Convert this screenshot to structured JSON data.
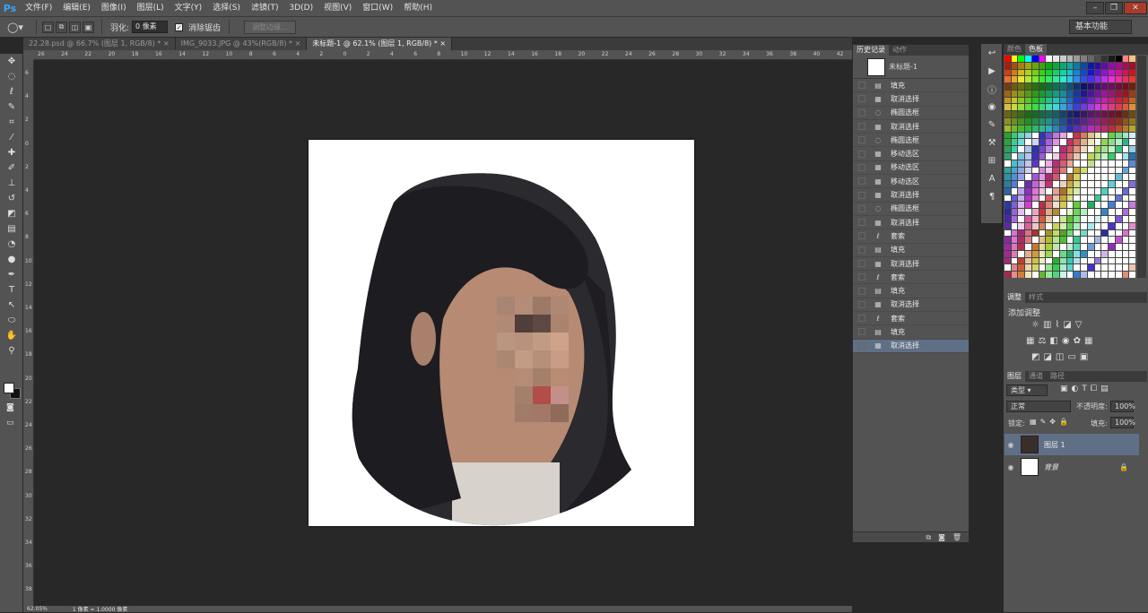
{
  "app": {
    "logo": "Ps"
  },
  "menu": [
    "文件(F)",
    "编辑(E)",
    "图像(I)",
    "图层(L)",
    "文字(Y)",
    "选择(S)",
    "滤镜(T)",
    "3D(D)",
    "视图(V)",
    "窗口(W)",
    "帮助(H)"
  ],
  "options": {
    "feather_label": "羽化:",
    "feather_value": "0 像素",
    "antialias_label": "消除锯齿",
    "refine_label": "调整边缘..."
  },
  "workspace": "基本功能",
  "tabs": [
    {
      "label": "22.28.psd @ 66.7% (图层 1, RGB/8) *"
    },
    {
      "label": "IMG_9033.JPG @ 43%(RGB/8) *"
    },
    {
      "label": "未标题-1 @ 62.1% (图层 1, RGB/8) *"
    }
  ],
  "ruler_top": [
    "26",
    "24",
    "22",
    "20",
    "18",
    "16",
    "14",
    "12",
    "10",
    "8",
    "6",
    "4",
    "2",
    "0",
    "2",
    "4",
    "6",
    "8",
    "10",
    "12",
    "14",
    "16",
    "18",
    "20",
    "22",
    "24",
    "26",
    "28",
    "30",
    "32",
    "34",
    "36",
    "38",
    "40",
    "42"
  ],
  "ruler_left": [
    "6",
    "4",
    "2",
    "0",
    "2",
    "4",
    "6",
    "8",
    "10",
    "12",
    "14",
    "16",
    "18",
    "20",
    "22",
    "24",
    "26",
    "28",
    "30",
    "32",
    "34",
    "36",
    "38"
  ],
  "status": {
    "zoom": "62.05%",
    "info": "1 像素 = 1.0000 像素"
  },
  "history": {
    "tabs": [
      "历史记录",
      "动作"
    ],
    "snapshot": "未标题-1",
    "items": [
      {
        "icon": "fill",
        "label": "填充"
      },
      {
        "icon": "deselect",
        "label": "取消选择"
      },
      {
        "icon": "ellipse",
        "label": "椭圆选框"
      },
      {
        "icon": "deselect",
        "label": "取消选择"
      },
      {
        "icon": "ellipse",
        "label": "椭圆选框"
      },
      {
        "icon": "move",
        "label": "移动选区"
      },
      {
        "icon": "move",
        "label": "移动选区"
      },
      {
        "icon": "move",
        "label": "移动选区"
      },
      {
        "icon": "deselect",
        "label": "取消选择"
      },
      {
        "icon": "ellipse",
        "label": "椭圆选框"
      },
      {
        "icon": "deselect",
        "label": "取消选择"
      },
      {
        "icon": "lasso",
        "label": "套索"
      },
      {
        "icon": "fill",
        "label": "填充"
      },
      {
        "icon": "deselect",
        "label": "取消选择"
      },
      {
        "icon": "lasso",
        "label": "套索"
      },
      {
        "icon": "fill",
        "label": "填充"
      },
      {
        "icon": "deselect",
        "label": "取消选择"
      },
      {
        "icon": "lasso",
        "label": "套索"
      },
      {
        "icon": "fill",
        "label": "填充"
      },
      {
        "icon": "deselect",
        "label": "取消选择"
      }
    ]
  },
  "color_panel": {
    "tabs": [
      "颜色",
      "色板"
    ]
  },
  "adjust_panel": {
    "tabs": [
      "调整",
      "样式"
    ],
    "title": "添加调整"
  },
  "layers_panel": {
    "tabs": [
      "图层",
      "通道",
      "路径"
    ],
    "filter": "类型",
    "blend": "正常",
    "opacity_label": "不透明度:",
    "opacity": "100%",
    "lock_label": "锁定:",
    "fill_label": "填充:",
    "fill": "100%",
    "layers": [
      {
        "name": "图层 1"
      },
      {
        "name": "背景"
      }
    ]
  }
}
